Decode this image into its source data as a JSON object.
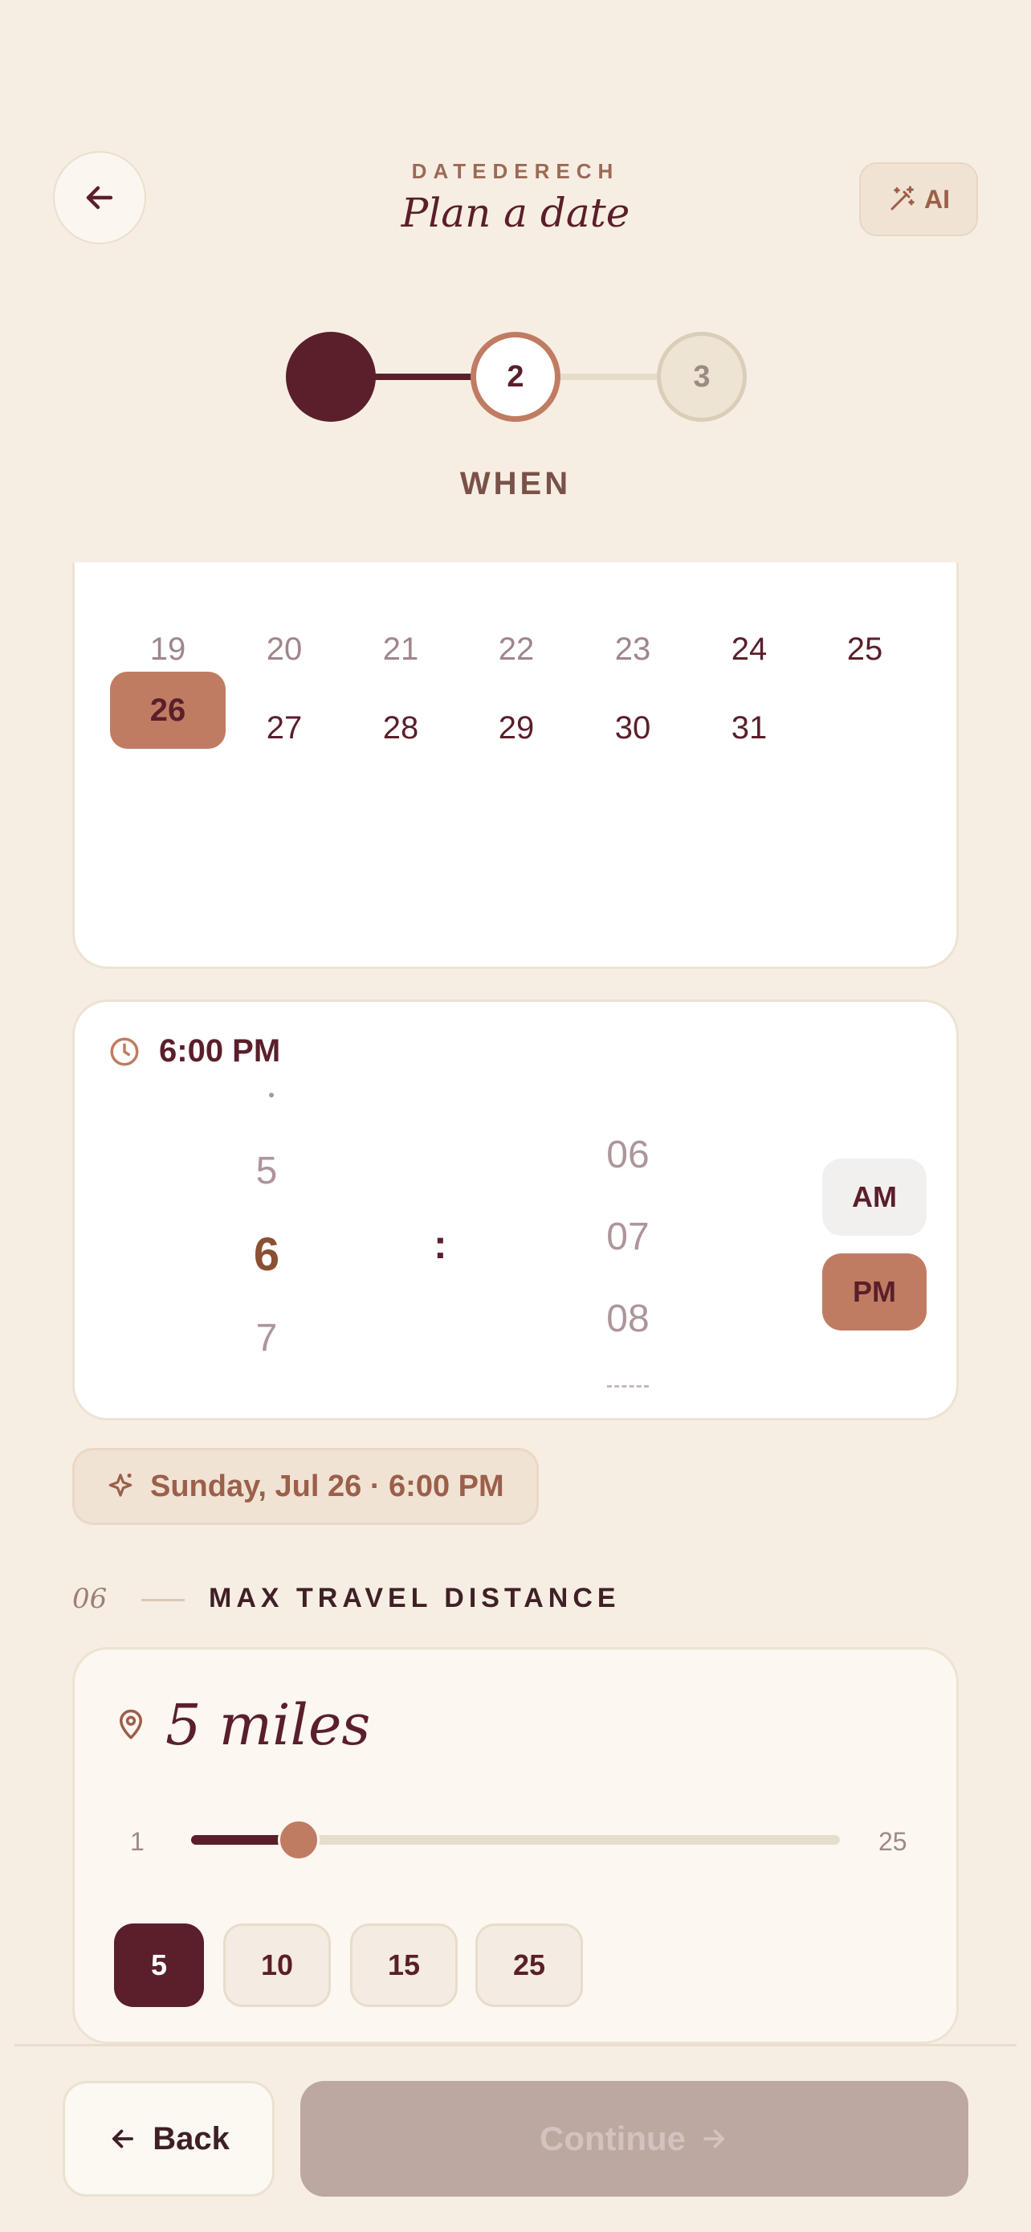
{
  "header": {
    "brand": "DATEDERECH",
    "title": "Plan a date",
    "ai_label": "AI"
  },
  "stepper": {
    "steps": [
      "",
      "2",
      "3"
    ],
    "current_label": "WHEN"
  },
  "calendar": {
    "rows": [
      [
        "19",
        "20",
        "21",
        "22",
        "23",
        "24",
        "25"
      ],
      [
        "26",
        "27",
        "28",
        "29",
        "30",
        "31"
      ]
    ],
    "selected_day": "26"
  },
  "time_picker": {
    "display": "6:00 PM",
    "hours": [
      "5",
      "6",
      "7"
    ],
    "selected_hour": "6",
    "separator": ":",
    "minutes": [
      "06",
      "07",
      "08"
    ],
    "am_label": "AM",
    "pm_label": "PM",
    "selected_period": "PM"
  },
  "summary": "Sunday, Jul 26 · 6:00 PM",
  "travel": {
    "section_number": "06",
    "section_title": "MAX TRAVEL DISTANCE",
    "value_label": "5 miles",
    "slider_min": "1",
    "slider_max": "25",
    "slider_value": 5,
    "presets": [
      "5",
      "10",
      "15",
      "25"
    ],
    "selected_preset": "5"
  },
  "footer": {
    "back_label": "Back",
    "continue_label": "Continue"
  },
  "colors": {
    "background": "#f7eee3",
    "primary": "#5a1f2a",
    "accent": "#c07c62",
    "disabled": "#bca7a1"
  }
}
